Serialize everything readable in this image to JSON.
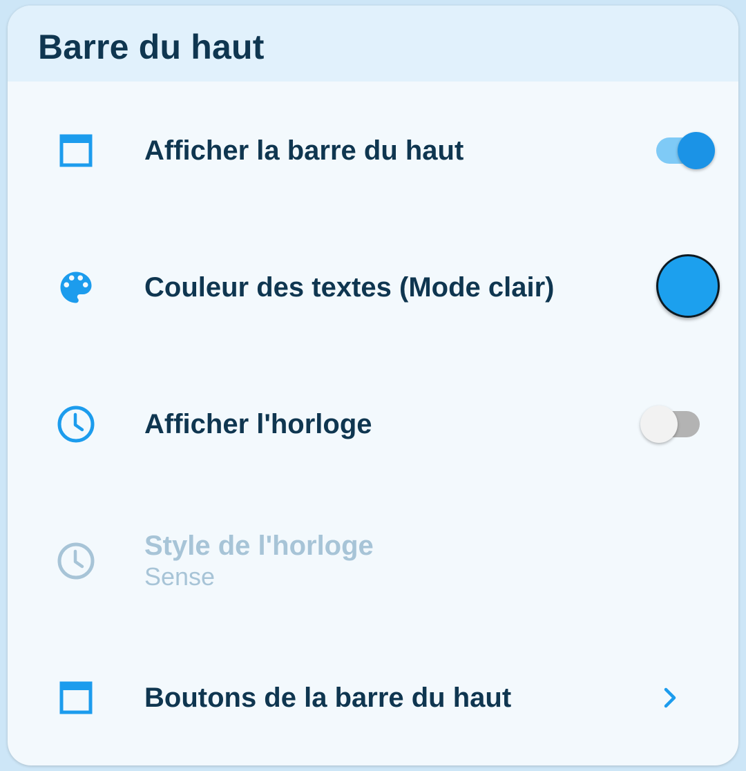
{
  "section": {
    "title": "Barre du haut"
  },
  "rows": [
    {
      "label": "Afficher la barre du haut",
      "icon": "window-icon",
      "control": "toggle",
      "checked": true
    },
    {
      "label": "Couleur des textes (Mode clair)",
      "icon": "palette-icon",
      "control": "color",
      "color": "#1ca0ee"
    },
    {
      "label": "Afficher l'horloge",
      "icon": "clock-icon",
      "control": "toggle",
      "checked": false
    },
    {
      "label": "Style de l'horloge",
      "sublabel": "Sense",
      "icon": "clock-icon",
      "enabled": false
    },
    {
      "label": "Boutons de la barre du haut",
      "icon": "window-icon",
      "control": "chevron"
    }
  ],
  "colors": {
    "accent": "#1b93e6",
    "text": "#0f3650",
    "disabled_text": "#a7c4d7",
    "header_bg": "#e1f1fc",
    "card_bg": "#f3f9fd"
  }
}
